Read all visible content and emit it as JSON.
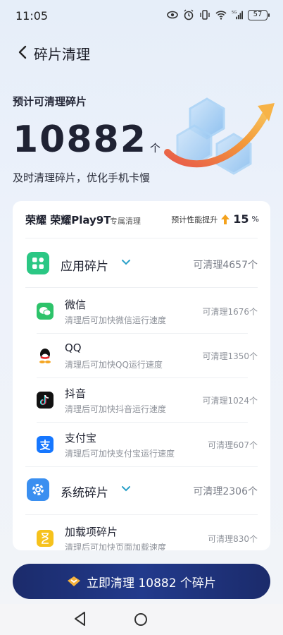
{
  "status_bar": {
    "time": "11:05",
    "battery": "57",
    "icons": [
      "eye-icon",
      "alarm-icon",
      "vibrate-icon",
      "wifi-icon",
      "5g-signal-icon"
    ]
  },
  "header": {
    "title": "碎片清理",
    "back_icon": "chevron-left-icon"
  },
  "hero": {
    "label": "预计可清理碎片",
    "count": "10882",
    "unit": "个",
    "subtitle": "及时清理碎片，优化手机卡慢"
  },
  "card": {
    "brand": "荣耀 荣耀Play9T",
    "brand_note": "专属清理",
    "perf_label": "预计性能提升",
    "perf_value": "15",
    "perf_unit": "%",
    "categories": [
      {
        "label": "应用碎片",
        "count": "可清理4657个",
        "icon": "apps-grid-icon",
        "apps": [
          {
            "name": "微信",
            "desc": "清理后可加快微信运行速度",
            "count": "可清理1676个",
            "icon": "wechat-icon"
          },
          {
            "name": "QQ",
            "desc": "清理后可加快QQ运行速度",
            "count": "可清理1350个",
            "icon": "qq-icon"
          },
          {
            "name": "抖音",
            "desc": "清理后可加快抖音运行速度",
            "count": "可清理1024个",
            "icon": "douyin-icon"
          },
          {
            "name": "支付宝",
            "desc": "清理后可加快支付宝运行速度",
            "count": "可清理607个",
            "icon": "alipay-icon"
          }
        ]
      },
      {
        "label": "系统碎片",
        "count": "可清理2306个",
        "icon": "settings-gear-icon",
        "apps": [
          {
            "name": "加载项碎片",
            "desc": "清理后可加快页面加载速度",
            "count": "可清理830个",
            "icon": "hourglass-icon"
          }
        ]
      }
    ]
  },
  "cta": {
    "label": "立即清理 10882 个碎片"
  },
  "colors": {
    "accent_green": "#2bc784",
    "accent_blue": "#3a8ff0",
    "cta_bg": "#1e2f74",
    "perf_arrow": "#f4a21d"
  }
}
